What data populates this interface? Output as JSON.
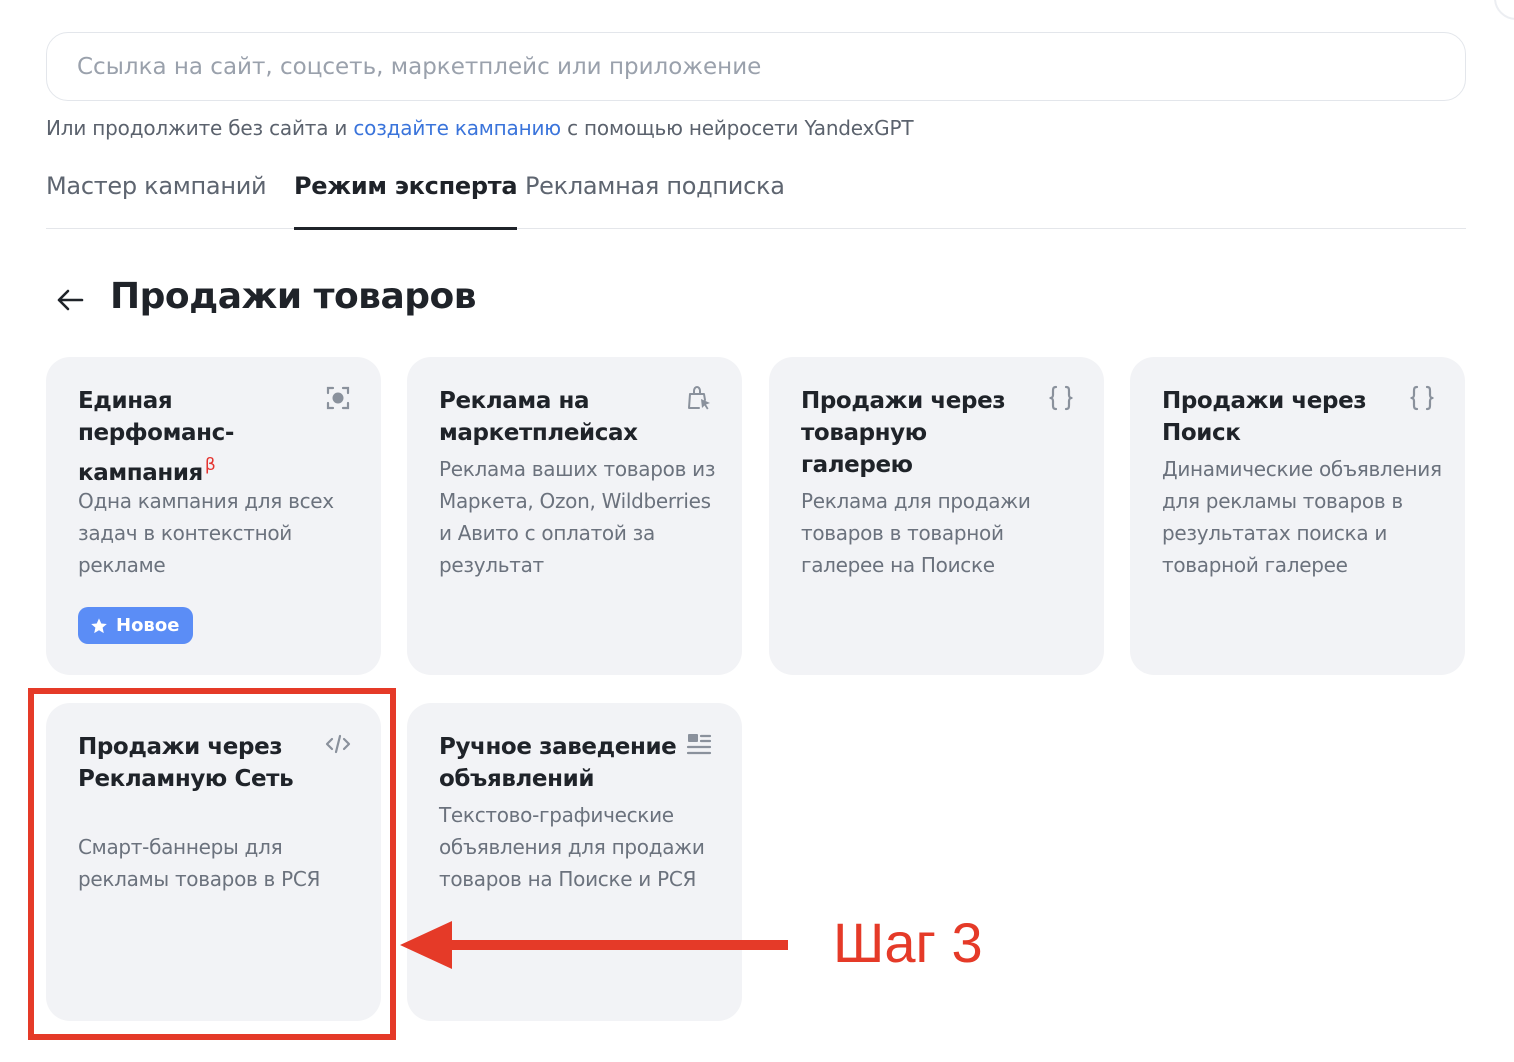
{
  "search": {
    "placeholder": "Ссылка на сайт, соцсеть, маркетплейс или приложение",
    "value": ""
  },
  "hint": {
    "before": "Или продолжите без сайта и ",
    "link": "создайте кампанию",
    "after": " с помощью нейросети YandexGPT"
  },
  "tabs": [
    {
      "label": "Мастер кампаний",
      "active": false
    },
    {
      "label": "Режим эксперта",
      "active": true
    },
    {
      "label": "Рекламная подписка",
      "active": false
    }
  ],
  "page": {
    "title": "Продажи товаров",
    "back_icon": "arrow-left-icon"
  },
  "cards": [
    {
      "title": "Единая перфоманс-кампания",
      "beta": "β",
      "description": "Одна кампания для всех задач в контекстной рекламе",
      "icon": "target-icon",
      "badge": "Новое",
      "badge_icon": "star-icon"
    },
    {
      "title": "Реклама на маркетплейсах",
      "description": "Реклама ваших товаров из Маркета, Ozon, Wildberries и Авито с оплатой за результат",
      "icon": "shopping-bag-cursor-icon"
    },
    {
      "title": "Продажи через товарную галерею",
      "description": "Реклама для продажи товаров в товарной галерее на Поиске",
      "icon": "curly-braces-icon"
    },
    {
      "title": "Продажи через Поиск",
      "description": "Динамические объявления для рекламы товаров в результатах поиска и товарной галерее",
      "icon": "curly-braces-icon"
    },
    {
      "title": "Продажи через Рекламную Сеть",
      "description": "Смарт-баннеры для рекламы товаров в РСЯ",
      "icon": "code-tag-icon"
    },
    {
      "title": "Ручное заведение объявлений",
      "description": "Текстово-графические объявления для продажи товаров на Поиске и РСЯ",
      "icon": "list-lines-icon"
    }
  ],
  "annotation": {
    "label": "Шаг 3",
    "color": "#e53a28"
  },
  "colors": {
    "link": "#3a74db",
    "badge": "#5b8df6",
    "card_bg": "#f2f3f6",
    "beta": "#e4332f"
  }
}
